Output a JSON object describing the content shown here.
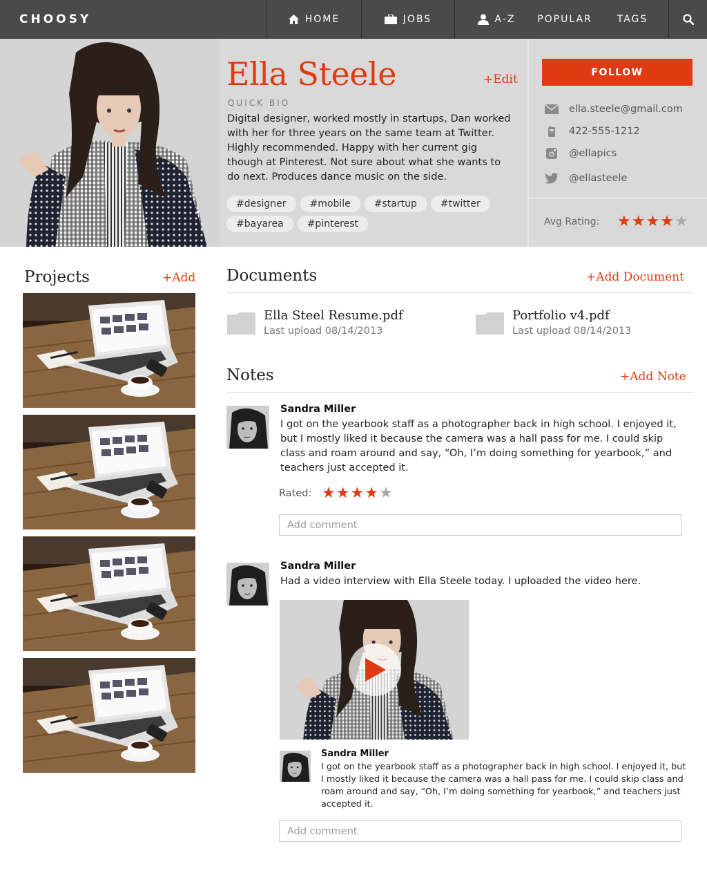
{
  "nav": {
    "logo": "CHOOSY",
    "items": [
      {
        "label": "HOME",
        "icon": "home-icon"
      },
      {
        "label": "JOBS",
        "icon": "briefcase-icon"
      },
      {
        "label": "A-Z",
        "icon": "person-icon"
      },
      {
        "label": "POPULAR",
        "icon": ""
      },
      {
        "label": "TAGS",
        "icon": ""
      }
    ],
    "search_icon": "search-icon"
  },
  "profile": {
    "name": "Ella Steele",
    "edit_label": "+Edit",
    "bio_label": "QUICK BIO",
    "bio": "Digital designer, worked mostly in startups, Dan worked with her for three years on the same team at Twitter. Highly recommended. Happy with her current gig though at Pinterest. Not sure about what she wants to do next. Produces dance music on the side.",
    "tags": [
      "#designer",
      "#mobile",
      "#startup",
      "#twitter",
      "#bayarea",
      "#pinterest"
    ],
    "follow_label": "FOLLOW",
    "contacts": [
      {
        "icon": "mail-icon",
        "value": "ella.steele@gmail.com"
      },
      {
        "icon": "phone-icon",
        "value": "422-555-1212"
      },
      {
        "icon": "instagram-icon",
        "value": "@ellapics"
      },
      {
        "icon": "twitter-icon",
        "value": "@ellasteele"
      }
    ],
    "avg_rating_label": "Avg Rating:",
    "avg_rating": 4,
    "max_rating": 5
  },
  "projects": {
    "title": "Projects",
    "add_label": "+Add",
    "count": 4
  },
  "documents": {
    "title": "Documents",
    "add_label": "+Add Document",
    "items": [
      {
        "name": "Ella Steel Resume.pdf",
        "meta": "Last upload 08/14/2013"
      },
      {
        "name": "Portfolio v4.pdf",
        "meta": "Last upload 08/14/2013"
      }
    ]
  },
  "notes": {
    "title": "Notes",
    "add_label": "+Add Note",
    "items": [
      {
        "author": "Sandra Miller",
        "body": "I got on the yearbook staff as a photographer back in high school. I enjoyed it, but I mostly liked it because the camera was a hall pass for me. I could skip class and roam around and say, “Oh, I’m doing something for yearbook,” and teachers just accepted it.",
        "rated_label": "Rated:",
        "rating": 4,
        "comment_placeholder": "Add comment"
      },
      {
        "author": "Sandra Miller",
        "body": "Had a video interview with Ella Steele today. I uploaded the video here.",
        "reply": {
          "author": "Sandra Miller",
          "body": "I got on the yearbook staff as a photographer back in high school. I enjoyed it, but I mostly liked it because the camera was a hall pass for me. I could skip class and roam around and say, “Oh, I’m doing something for yearbook,” and teachers just accepted it."
        },
        "comment_placeholder": "Add comment"
      }
    ]
  },
  "colors": {
    "accent": "#e03a12",
    "nav_bg": "#4a4a4a",
    "hero_bg": "#d9d9d9"
  }
}
